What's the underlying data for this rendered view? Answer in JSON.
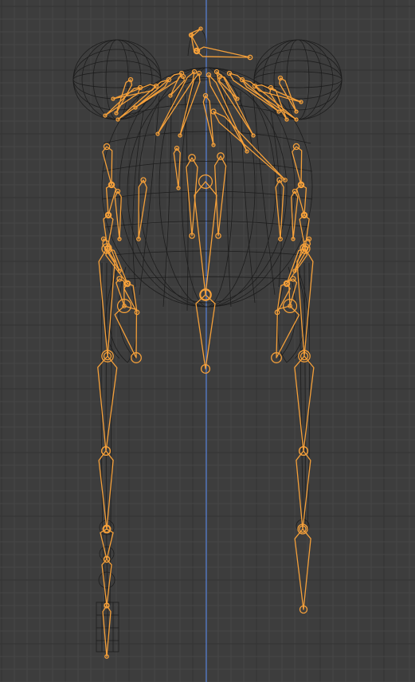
{
  "viewport": {
    "background": "#3d3d3d",
    "grid_minor_color": "#464646",
    "grid_major_color": "#333333",
    "axis_color": "#5277c4",
    "mesh_color": "#1a1a1a",
    "bone_color": "#f5a03a",
    "mode": "pose-wireframe"
  },
  "objects": {
    "mesh": "hair-wireframe-mesh",
    "armature": "hair-armature"
  }
}
